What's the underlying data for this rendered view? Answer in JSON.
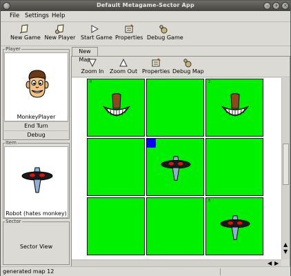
{
  "window": {
    "title": "Default Metagame-Sector App"
  },
  "menu": {
    "items": [
      "File",
      "Settings",
      "Help"
    ]
  },
  "toolbar": {
    "buttons": [
      "New Game",
      "New Player",
      "Start Game",
      "Properties",
      "Debug Game"
    ]
  },
  "player_panel": {
    "caption": "Player",
    "name": "MonkeyPlayer",
    "end_turn_label": "End Turn",
    "debug_label": "Debug"
  },
  "item_panel": {
    "caption": "Item",
    "name": "Robot (hates monkey)"
  },
  "sector_panel": {
    "caption": "Sector",
    "label": "Sector View"
  },
  "tabs": [
    "New Map"
  ],
  "map_toolbar": {
    "buttons": [
      "Zoom In",
      "Zoom Out",
      "Properties",
      "Debug Map"
    ]
  },
  "grid": {
    "cell_labels": [
      "0",
      "",
      "2",
      "",
      "",
      "",
      "",
      "",
      "8"
    ],
    "cell_contents": [
      "monkey",
      "empty",
      "monkey",
      "empty",
      "robot",
      "empty",
      "empty",
      "empty",
      "robot"
    ],
    "cell_color": "#00f100",
    "marker_color": "#0000ff"
  },
  "status": {
    "text": "generated map 12"
  },
  "colors": {
    "window_bg": "#dcdad5",
    "title_bg": "#45443f"
  }
}
